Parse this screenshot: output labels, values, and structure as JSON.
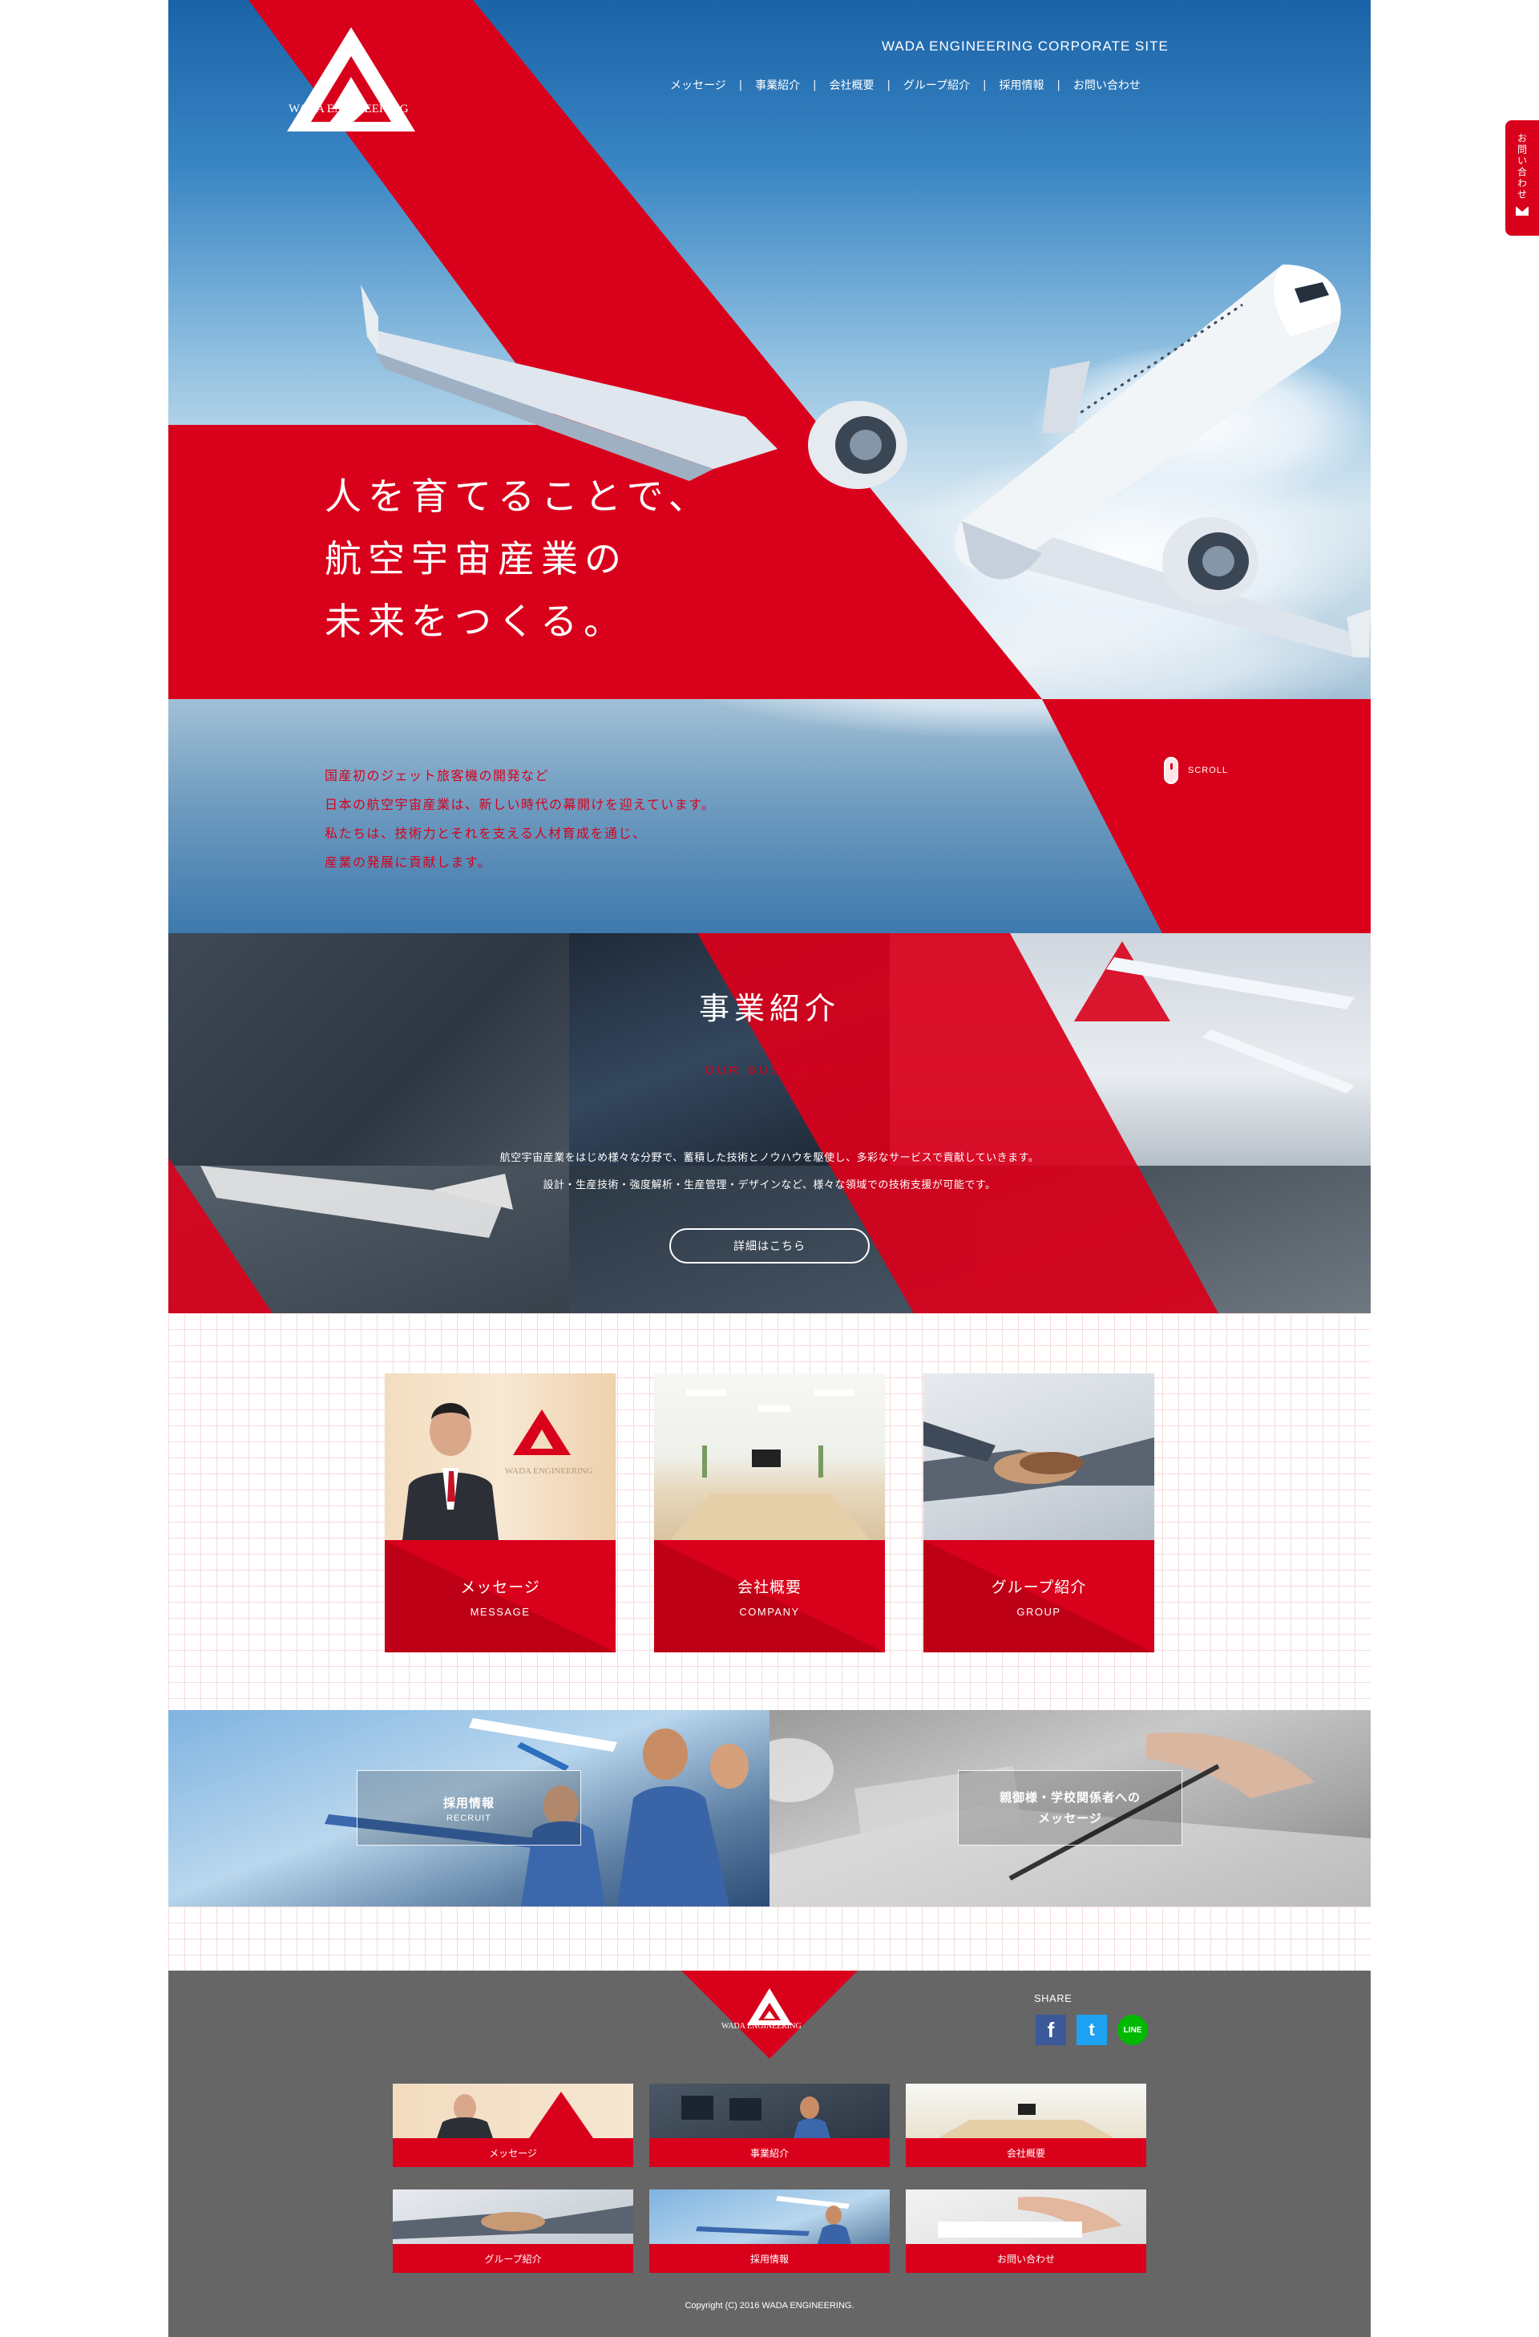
{
  "site": {
    "title": "WADA ENGINEERING CORPORATE SITE",
    "logo_text": "WADA ENGINEERING"
  },
  "nav": [
    {
      "label": "メッセージ"
    },
    {
      "label": "事業紹介"
    },
    {
      "label": "会社概要"
    },
    {
      "label": "グループ紹介"
    },
    {
      "label": "採用情報"
    },
    {
      "label": "お問い合わせ"
    }
  ],
  "hero": {
    "catch": [
      "人を育てることで、",
      "航空宇宙産業の",
      "未来をつくる。"
    ],
    "intro": [
      "国産初のジェット旅客機の開発など",
      "日本の航空宇宙産業は、新しい時代の幕開けを迎えています。",
      "私たちは、技術力とそれを支える人材育成を通じ、",
      "産業の発展に貢献します。"
    ],
    "scroll_label": "SCROLL"
  },
  "business": {
    "title": "事業紹介",
    "subtitle": "OUR BUSINESS",
    "desc": [
      "航空宇宙産業をはじめ様々な分野で、蓄積した技術とノウハウを駆使し、多彩なサービスで貢献していきます。",
      "設計・生産技術・強度解析・生産管理・デザインなど、様々な領域での技術支援が可能です。"
    ],
    "button": "詳細はこちら"
  },
  "cards": [
    {
      "jp": "メッセージ",
      "en": "MESSAGE"
    },
    {
      "jp": "会社概要",
      "en": "COMPANY"
    },
    {
      "jp": "グループ紹介",
      "en": "GROUP"
    }
  ],
  "banners": {
    "recruit": {
      "title": "採用情報",
      "sub": "RECRUIT"
    },
    "parents": {
      "line1": "親御様・学校関係者への",
      "line2": "メッセージ"
    }
  },
  "footer": {
    "logo_text": "WADA ENGINEERING",
    "share_label": "SHARE",
    "sns": [
      {
        "name": "facebook",
        "glyph": "f",
        "color": "#3b5998"
      },
      {
        "name": "twitter",
        "glyph": "t",
        "color": "#1da1f2"
      },
      {
        "name": "line",
        "glyph": "LINE",
        "color": "#00b900"
      }
    ],
    "links": [
      {
        "label": "メッセージ"
      },
      {
        "label": "事業紹介"
      },
      {
        "label": "会社概要"
      },
      {
        "label": "グループ紹介"
      },
      {
        "label": "採用情報"
      },
      {
        "label": "お問い合わせ"
      }
    ],
    "copyright": "Copyright (C) 2016 WADA ENGINEERING."
  },
  "side_tab": {
    "label": "お問い合わせ"
  },
  "colors": {
    "brand_red": "#d9001b",
    "footer_gray": "#666666"
  }
}
